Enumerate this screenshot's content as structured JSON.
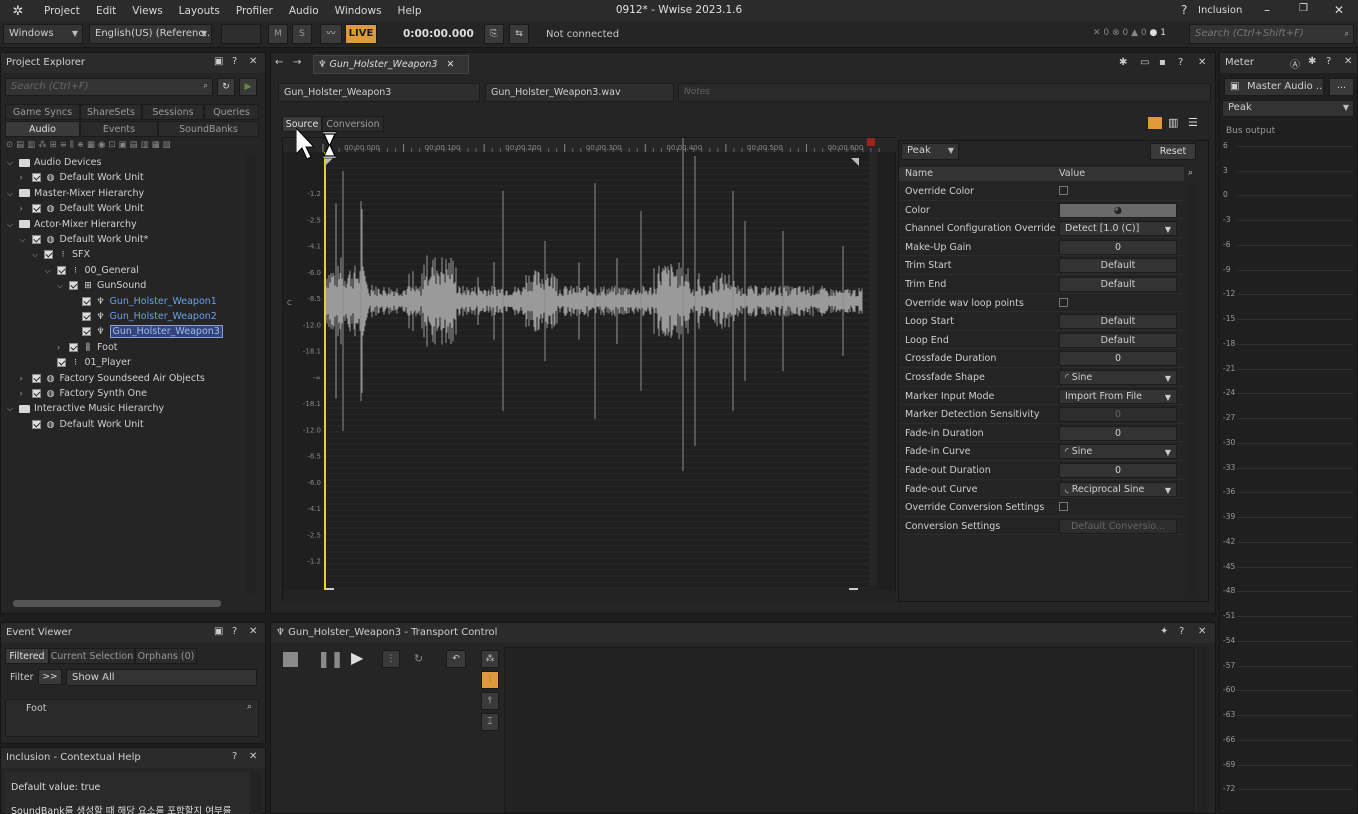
{
  "app": {
    "title": "0912* - Wwise 2023.1.6",
    "menu": [
      "Project",
      "Edit",
      "Views",
      "Layouts",
      "Profiler",
      "Audio",
      "Windows",
      "Help"
    ],
    "layout_label": "Inclusion",
    "search_placeholder": "Search (Ctrl+Shift+F)"
  },
  "toolbar": {
    "platform": "Windows",
    "language": "English(US) (Referenc...",
    "mute": "M",
    "solo": "S",
    "live": "LIVE",
    "time": "0:00:00.000",
    "connection": "Not connected",
    "counters": [
      "0",
      "0",
      "0",
      "1"
    ]
  },
  "project_explorer": {
    "title": "Project Explorer",
    "search_placeholder": "Search (Ctrl+F)",
    "tabs_row1": [
      "Game Syncs",
      "ShareSets",
      "Sessions",
      "Queries"
    ],
    "tabs_row2": [
      "Audio",
      "Events",
      "SoundBanks"
    ],
    "tree": [
      {
        "label": "Audio Devices",
        "indent": 0,
        "twisty": "v",
        "type": "folder"
      },
      {
        "label": "Default Work Unit",
        "indent": 1,
        "twisty": ">",
        "type": "wu"
      },
      {
        "label": "Master-Mixer Hierarchy",
        "indent": 0,
        "twisty": "v",
        "type": "folder"
      },
      {
        "label": "Default Work Unit",
        "indent": 1,
        "twisty": ">",
        "type": "wu"
      },
      {
        "label": "Actor-Mixer Hierarchy",
        "indent": 0,
        "twisty": "v",
        "type": "folder"
      },
      {
        "label": "Default Work Unit*",
        "indent": 1,
        "twisty": "v",
        "type": "wu"
      },
      {
        "label": "SFX",
        "indent": 2,
        "twisty": "v",
        "type": "mixer"
      },
      {
        "label": "00_General",
        "indent": 3,
        "twisty": "v",
        "type": "mixer"
      },
      {
        "label": "GunSound",
        "indent": 4,
        "twisty": "v",
        "type": "random"
      },
      {
        "label": "Gun_Holster_Weapon1",
        "indent": 5,
        "twisty": "",
        "type": "sound",
        "link": true
      },
      {
        "label": "Gun_Holster_Weapon2",
        "indent": 5,
        "twisty": "",
        "type": "sound",
        "link": true
      },
      {
        "label": "Gun_Holster_Weapon3",
        "indent": 5,
        "twisty": "",
        "type": "sound",
        "link": true,
        "selected": true
      },
      {
        "label": "Foot",
        "indent": 4,
        "twisty": ">",
        "type": "switch"
      },
      {
        "label": "01_Player",
        "indent": 3,
        "twisty": "",
        "type": "mixer"
      },
      {
        "label": "Factory Soundseed Air Objects",
        "indent": 1,
        "twisty": ">",
        "type": "wu"
      },
      {
        "label": "Factory Synth One",
        "indent": 1,
        "twisty": ">",
        "type": "wu"
      },
      {
        "label": "Interactive Music Hierarchy",
        "indent": 0,
        "twisty": "v",
        "type": "folder"
      },
      {
        "label": "Default Work Unit",
        "indent": 1,
        "twisty": "",
        "type": "wu"
      }
    ]
  },
  "editor": {
    "tab_title": "Gun_Holster_Weapon3",
    "name_field": "Gun_Holster_Weapon3",
    "file_field": "Gun_Holster_Weapon3.wav",
    "notes_placeholder": "Notes",
    "sub_tabs": [
      "Source",
      "Conversion"
    ],
    "ruler_labels": [
      "00:00.000",
      "00:00.100",
      "00:00.200",
      "00:00.300",
      "00:00.400",
      "00:00.500",
      "00:00.600"
    ],
    "db_labels": [
      "-1.2",
      "-2.5",
      "-4.1",
      "-6.0",
      "-8.5",
      "-12.0",
      "-18.1",
      "-∞",
      "-18.1",
      "-12.0",
      "-8.5",
      "-6.0",
      "-4.1",
      "-2.5",
      "-1.2"
    ],
    "channel_label": "C"
  },
  "properties": {
    "mode": "Peak",
    "reset": "Reset",
    "col_name": "Name",
    "col_value": "Value",
    "rows": [
      {
        "name": "Override Color",
        "kind": "check"
      },
      {
        "name": "Color",
        "kind": "color",
        "value": "◕"
      },
      {
        "name": "Channel Configuration Override",
        "kind": "combo",
        "value": "Detect [1.0 (C)]"
      },
      {
        "name": "Make-Up Gain",
        "kind": "num",
        "value": "0"
      },
      {
        "name": "Trim Start",
        "kind": "num",
        "value": "Default"
      },
      {
        "name": "Trim End",
        "kind": "num",
        "value": "Default"
      },
      {
        "name": "Override wav loop points",
        "kind": "check"
      },
      {
        "name": "Loop Start",
        "kind": "num",
        "value": "Default"
      },
      {
        "name": "Loop End",
        "kind": "num",
        "value": "Default"
      },
      {
        "name": "Crossfade Duration",
        "kind": "num",
        "value": "0"
      },
      {
        "name": "Crossfade Shape",
        "kind": "combo",
        "value": "◜ Sine"
      },
      {
        "name": "Marker Input Mode",
        "kind": "combo",
        "value": "Import From File"
      },
      {
        "name": "Marker Detection Sensitivity",
        "kind": "dis",
        "value": "0"
      },
      {
        "name": "Fade-in Duration",
        "kind": "num",
        "value": "0"
      },
      {
        "name": "Fade-in Curve",
        "kind": "combo",
        "value": "◜ Sine"
      },
      {
        "name": "Fade-out Duration",
        "kind": "num",
        "value": "0"
      },
      {
        "name": "Fade-out Curve",
        "kind": "combo",
        "value": "◟ Reciprocal Sine"
      },
      {
        "name": "Override Conversion Settings",
        "kind": "check"
      },
      {
        "name": "Conversion Settings",
        "kind": "dis",
        "value": "Default Conversio..."
      }
    ]
  },
  "meter": {
    "title": "Meter",
    "bus": "Master Audio ...",
    "mode": "Peak",
    "section": "Bus output",
    "scale": [
      "6",
      "3",
      "0",
      "-3",
      "-6",
      "-9",
      "-12",
      "-15",
      "-18",
      "-21",
      "-24",
      "-27",
      "-30",
      "-33",
      "-36",
      "-39",
      "-42",
      "-45",
      "-48",
      "-51",
      "-54",
      "-57",
      "-60",
      "-63",
      "-66",
      "-69",
      "-72"
    ]
  },
  "event_viewer": {
    "title": "Event Viewer",
    "tabs": [
      "Filtered",
      "Current Selection",
      "Orphans (0)"
    ],
    "filter_label": "Filter",
    "filter_btn": ">>",
    "filter_value": "Show All",
    "search_value": "Foot"
  },
  "help": {
    "title": "Inclusion - Contextual Help",
    "line1": "Default value: true",
    "line2": "SoundBank를 생성할 때 해당 요소를 포함할지 여부를"
  },
  "transport": {
    "title": "Gun_Holster_Weapon3 - Transport Control"
  }
}
